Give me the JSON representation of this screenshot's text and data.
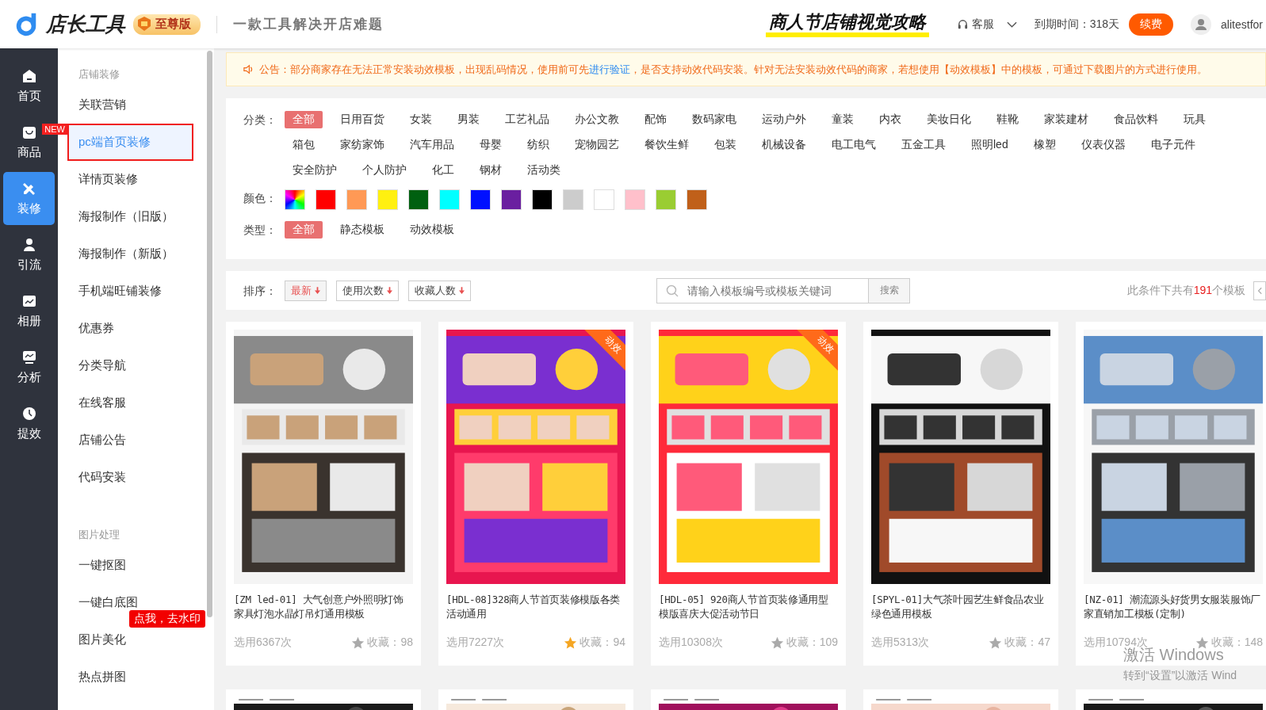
{
  "header": {
    "brand": "店长工具",
    "edition": "至尊版",
    "slogan": "一款工具解决开店难题",
    "promo": "商人节店铺视觉攻略",
    "service": "客服",
    "expiry": "到期时间：318天",
    "renew": "续费",
    "username": "alitestfor"
  },
  "rail": [
    {
      "label": "首页",
      "selected": false
    },
    {
      "label": "商品",
      "selected": false,
      "badge": "NEW"
    },
    {
      "label": "装修",
      "selected": true
    },
    {
      "label": "引流",
      "selected": false
    },
    {
      "label": "相册",
      "selected": false
    },
    {
      "label": "分析",
      "selected": false
    },
    {
      "label": "提效",
      "selected": false
    }
  ],
  "submenu": [
    {
      "title": "店铺装修",
      "items": [
        {
          "label": "关联营销",
          "selected": false
        },
        {
          "label": "pc端首页装修",
          "selected": true
        },
        {
          "label": "详情页装修",
          "selected": false
        },
        {
          "label": "海报制作（旧版）",
          "selected": false
        },
        {
          "label": "海报制作（新版）",
          "selected": false
        },
        {
          "label": "手机端旺铺装修",
          "selected": false
        },
        {
          "label": "优惠券",
          "selected": false
        },
        {
          "label": "分类导航",
          "selected": false
        },
        {
          "label": "在线客服",
          "selected": false
        },
        {
          "label": "店铺公告",
          "selected": false
        },
        {
          "label": "代码安装",
          "selected": false
        }
      ]
    },
    {
      "title": "图片处理",
      "items": [
        {
          "label": "一键抠图",
          "selected": false
        },
        {
          "label": "一键白底图",
          "selected": false
        },
        {
          "label": "图片美化",
          "selected": false,
          "tip": "点我，去水印"
        },
        {
          "label": "热点拼图",
          "selected": false
        }
      ]
    }
  ],
  "notice": {
    "before": "公告：部分商家存在无法正常安装动效模板，出现乱码情况，使用前可先",
    "link": "进行验证",
    "after": "，是否支持动效代码安装。针对无法安装动效代码的商家，若想使用【动效模板】中的模板，可通过下载图片的方式进行使用。"
  },
  "filters": {
    "categories": {
      "label": "分类：",
      "options": [
        {
          "label": "全部",
          "selected": true
        },
        {
          "label": "日用百货",
          "selected": false
        },
        {
          "label": "女装",
          "selected": false
        },
        {
          "label": "男装",
          "selected": false
        },
        {
          "label": "工艺礼品",
          "selected": false
        },
        {
          "label": "办公文教",
          "selected": false
        },
        {
          "label": "配饰",
          "selected": false
        },
        {
          "label": "数码家电",
          "selected": false
        },
        {
          "label": "运动户外",
          "selected": false
        },
        {
          "label": "童装",
          "selected": false
        },
        {
          "label": "内衣",
          "selected": false
        },
        {
          "label": "美妆日化",
          "selected": false
        },
        {
          "label": "鞋靴",
          "selected": false
        },
        {
          "label": "家装建材",
          "selected": false
        },
        {
          "label": "食品饮料",
          "selected": false
        },
        {
          "label": "玩具",
          "selected": false
        },
        {
          "label": "箱包",
          "selected": false
        },
        {
          "label": "家纺家饰",
          "selected": false
        },
        {
          "label": "汽车用品",
          "selected": false
        },
        {
          "label": "母婴",
          "selected": false
        },
        {
          "label": "纺织",
          "selected": false
        },
        {
          "label": "宠物园艺",
          "selected": false
        },
        {
          "label": "餐饮生鲜",
          "selected": false
        },
        {
          "label": "包装",
          "selected": false
        },
        {
          "label": "机械设备",
          "selected": false
        },
        {
          "label": "电工电气",
          "selected": false
        },
        {
          "label": "五金工具",
          "selected": false
        },
        {
          "label": "照明led",
          "selected": false
        },
        {
          "label": "橡塑",
          "selected": false
        },
        {
          "label": "仪表仪器",
          "selected": false
        },
        {
          "label": "电子元件",
          "selected": false
        },
        {
          "label": "安全防护",
          "selected": false
        },
        {
          "label": "个人防护",
          "selected": false
        },
        {
          "label": "化工",
          "selected": false
        },
        {
          "label": "钢材",
          "selected": false
        },
        {
          "label": "活动类",
          "selected": false
        }
      ]
    },
    "colors": {
      "label": "颜色：",
      "options": [
        {
          "kind": "all",
          "selected": false
        },
        {
          "kind": "swatch",
          "color": "#ff0000",
          "selected": false
        },
        {
          "kind": "swatch",
          "color": "#ff9955",
          "selected": false
        },
        {
          "kind": "swatch",
          "color": "#fff010",
          "selected": false
        },
        {
          "kind": "swatch",
          "color": "#006010",
          "selected": false
        },
        {
          "kind": "swatch",
          "color": "#00ffff",
          "selected": false
        },
        {
          "kind": "swatch",
          "color": "#0010ff",
          "selected": false
        },
        {
          "kind": "swatch",
          "color": "#6a1fa0",
          "selected": false
        },
        {
          "kind": "swatch",
          "color": "#000000",
          "selected": false
        },
        {
          "kind": "swatch",
          "color": "#cccccc",
          "selected": false
        },
        {
          "kind": "swatch",
          "color": "#ffffff",
          "selected": false
        },
        {
          "kind": "swatch",
          "color": "#ffc0cb",
          "selected": false
        },
        {
          "kind": "swatch",
          "color": "#9acd32",
          "selected": false
        },
        {
          "kind": "swatch",
          "color": "#c0601a",
          "selected": false
        }
      ]
    },
    "types": {
      "label": "类型：",
      "options": [
        {
          "label": "全部",
          "selected": true
        },
        {
          "label": "静态模板",
          "selected": false
        },
        {
          "label": "动效模板",
          "selected": false
        }
      ]
    }
  },
  "sort": {
    "label": "排序：",
    "options": [
      {
        "label": "最新",
        "selected": true
      },
      {
        "label": "使用次数",
        "selected": false
      },
      {
        "label": "收藏人数",
        "selected": false
      }
    ]
  },
  "search": {
    "placeholder": "请输入模板编号或模板关键词",
    "button": "搜索"
  },
  "result": {
    "prefix": "此条件下共有",
    "count": "191",
    "suffix": "个模板"
  },
  "templates": [
    {
      "title": "[ZM led-01] 大气创意户外照明灯饰家具灯泡水晶灯吊灯通用模板",
      "uses": "选用6367次",
      "favorites": "收藏：98",
      "starred": false
    },
    {
      "title": "[HDL-08]328商人节首页装修模版各类活动通用",
      "uses": "选用7227次",
      "favorites": "收藏：94",
      "starred": true,
      "badge": "动效"
    },
    {
      "title": "[HDL-05] 920商人节首页装修通用型模版喜庆大促活动节日",
      "uses": "选用10308次",
      "favorites": "收藏：109",
      "starred": false,
      "badge": "动效"
    },
    {
      "title": "[SPYL-01]大气茶叶园艺生鲜食品农业绿色通用模板",
      "uses": "选用5313次",
      "favorites": "收藏：47",
      "starred": false
    },
    {
      "title": "[NZ-01] 潮流源头好货男女服装服饰厂家直销加工模板(定制)",
      "uses": "选用10794次",
      "favorites": "收藏：148",
      "starred": false
    }
  ],
  "system_overlay": {
    "title": "激活 Windows",
    "hint": "转到“设置”以激活 Wind"
  }
}
